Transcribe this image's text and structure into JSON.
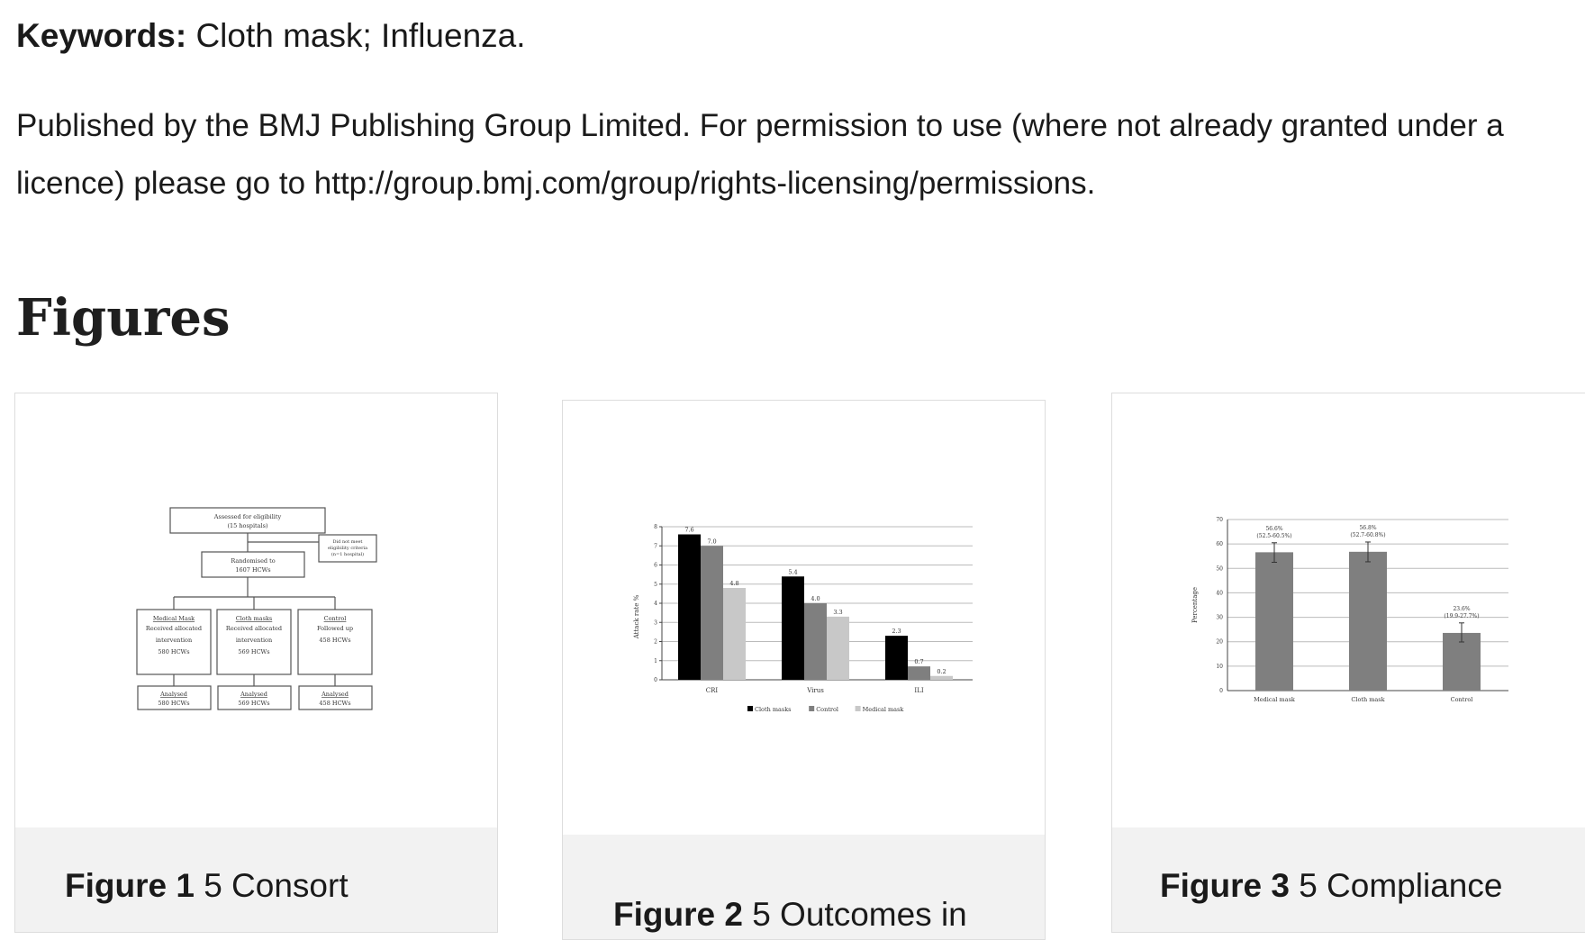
{
  "keywords": {
    "label": "Keywords:",
    "value": "Cloth mask; Influenza."
  },
  "publisher": {
    "line1": "Published by the BMJ Publishing Group Limited. For permission to use (where not already granted under a",
    "line2": "licence) please go to http://group.bmj.com/group/rights-licensing/permissions."
  },
  "figures_heading": "Figures",
  "figures": [
    {
      "label": "Figure 1",
      "caption": "5 Consort",
      "flow": {
        "top": [
          "Assessed for eligibility",
          "(15 hospitals)"
        ],
        "excluded": [
          "Did not meet",
          "eligibility criteria",
          "(n=1 hospital)"
        ],
        "randomised": [
          "Randomised to",
          "1607 HCWs"
        ],
        "arms": [
          {
            "title": "Medical Mask",
            "l1": "Received allocated",
            "l2": "intervention",
            "l3": "580 HCWs",
            "analysed": "580 HCWs"
          },
          {
            "title": "Cloth masks",
            "l1": "Received allocated",
            "l2": "intervention",
            "l3": "569 HCWs",
            "analysed": "569 HCWs"
          },
          {
            "title": "Control",
            "l1": "Followed up",
            "l2": "458 HCWs",
            "l3": "",
            "analysed": "458 HCWs"
          }
        ],
        "analysed_label": "Analysed"
      }
    },
    {
      "label": "Figure 2",
      "caption": "5 Outcomes in",
      "chart_data": {
        "type": "bar",
        "categories": [
          "CRI",
          "Virus",
          "ILI"
        ],
        "series": [
          {
            "name": "Cloth masks",
            "color": "#000000",
            "values": [
              7.6,
              5.4,
              2.3
            ]
          },
          {
            "name": "Control",
            "color": "#7f7f7f",
            "values": [
              7.0,
              4.0,
              0.7
            ]
          },
          {
            "name": "Medical mask",
            "color": "#c8c8c8",
            "values": [
              4.8,
              3.3,
              0.2
            ]
          }
        ],
        "value_labels": [
          [
            "7.6",
            "5.4",
            "2.3"
          ],
          [
            "7.0",
            "4.0",
            "0.7"
          ],
          [
            "4.8",
            "3.3",
            "0.2"
          ]
        ],
        "ylabel": "Attack rate %",
        "ylim": [
          0,
          8
        ],
        "yticks": [
          "0",
          "1",
          "2",
          "3",
          "4",
          "5",
          "6",
          "7",
          "8"
        ],
        "grid": true,
        "legend": "bottom"
      }
    },
    {
      "label": "Figure 3",
      "caption": "5 Compliance",
      "chart_data": {
        "type": "bar",
        "categories": [
          "Medical mask",
          "Cloth mask",
          "Control"
        ],
        "values": [
          56.6,
          56.8,
          23.6
        ],
        "labels": [
          [
            "56.6%",
            "(52.5-60.5%)"
          ],
          [
            "56.8%",
            "(52.7-60.8%)"
          ],
          [
            "23.6%",
            "(19.9-27.7%)"
          ]
        ],
        "errors_low": [
          52.5,
          52.7,
          19.9
        ],
        "errors_high": [
          60.5,
          60.8,
          27.7
        ],
        "ylabel": "Percentage",
        "ylim": [
          0,
          70
        ],
        "yticks": [
          "0",
          "10",
          "20",
          "30",
          "40",
          "50",
          "60",
          "70"
        ],
        "bar_color": "#7f7f7f",
        "grid": true
      }
    }
  ]
}
